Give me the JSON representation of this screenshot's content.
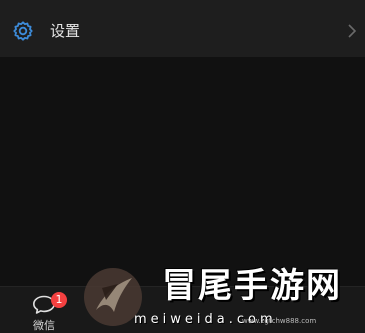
{
  "settings": {
    "label": "设置",
    "icon": "gear-icon",
    "trailing_icon": "chevron-right-icon"
  },
  "tab_bar": {
    "wechat": {
      "label": "微信",
      "icon": "chat-bubble-icon",
      "badge": "1"
    }
  },
  "watermark": {
    "title": "冒尾手游网",
    "subtitle": "meiweida.com",
    "url": "www.zgtchw888.com"
  },
  "colors": {
    "accent": "#3d8bd9",
    "badge": "#f44040",
    "background": "#111111",
    "row_background": "#1e1e1e"
  }
}
